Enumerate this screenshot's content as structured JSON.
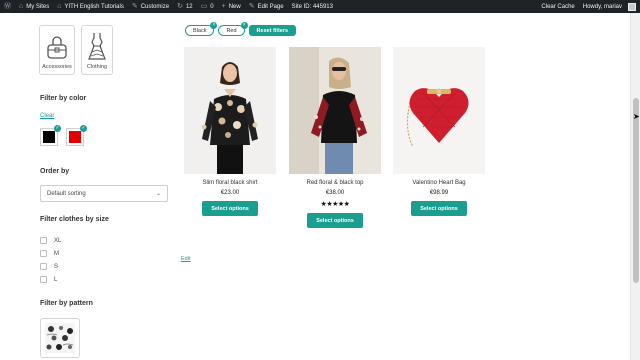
{
  "admin_bar": {
    "my_sites": "My Sites",
    "site_name": "YITH English Tutorials",
    "customize": "Customize",
    "comments_count": "12",
    "new_count": "0",
    "new": "New",
    "edit_page": "Edit Page",
    "site_id": "Site ID: 445913",
    "clear_cache": "Clear Cache",
    "howdy": "Howdy, mariav"
  },
  "sidebar": {
    "categories": [
      {
        "label": "Accessories",
        "icon": "bag-icon"
      },
      {
        "label": "Clothing",
        "icon": "dress-icon"
      }
    ],
    "filter_color_title": "Filter by color",
    "clear_label": "Clear",
    "colors": [
      {
        "name": "Black",
        "hex": "#000000"
      },
      {
        "name": "Red",
        "hex": "#e00000"
      }
    ],
    "order_title": "Order by",
    "order_selected": "Default sorting",
    "size_title": "Filter clothes by size",
    "sizes": [
      "XL",
      "M",
      "S",
      "L"
    ],
    "pattern_title": "Filter by pattern"
  },
  "active_filters": [
    {
      "label": "Black"
    },
    {
      "label": "Red"
    }
  ],
  "reset_label": "Reset filters",
  "products": [
    {
      "name": "Slim floral black shirt",
      "price": "€23.00",
      "button": "Select options",
      "rating": ""
    },
    {
      "name": "Red floral & black top",
      "price": "€38.00",
      "button": "Select options",
      "rating": "★★★★★"
    },
    {
      "name": "Valentino Heart Bag",
      "price": "€98.99",
      "button": "Select options",
      "rating": ""
    }
  ],
  "edit_label": "Edit",
  "colors": {
    "accent": "#1a9e8f",
    "admin_bar": "#1d2327"
  }
}
